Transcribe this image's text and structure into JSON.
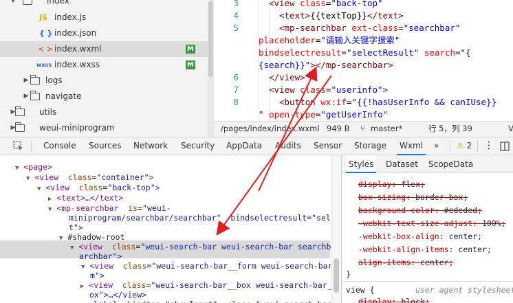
{
  "file_tree": {
    "items": [
      {
        "label": "index",
        "type": "folder",
        "expanded": true
      },
      {
        "label": "index.js",
        "type": "js",
        "icon": "JS"
      },
      {
        "label": "index.json",
        "type": "json",
        "icon": "{ }"
      },
      {
        "label": "index.wxml",
        "type": "wxml",
        "icon": "< >",
        "badge": "M",
        "selected": true
      },
      {
        "label": "index.wxss",
        "type": "wxss",
        "icon": "wxss",
        "badge": "M"
      },
      {
        "label": "logs",
        "type": "folder"
      },
      {
        "label": "navigate",
        "type": "folder"
      },
      {
        "label": "utils",
        "type": "folder"
      },
      {
        "label": "weui-miniprogram",
        "type": "folder"
      }
    ]
  },
  "editor": {
    "line_numbers": [
      "3",
      "4",
      "5",
      "6",
      "7",
      "8"
    ],
    "lines": [
      {
        "parts": [
          [
            "tag",
            "<view "
          ],
          [
            "attr",
            "class"
          ],
          [
            "txt",
            "="
          ],
          [
            "str",
            "\"back-top\""
          ]
        ]
      },
      {
        "parts": [
          [
            "tag",
            "<text>"
          ],
          [
            "txt",
            "{{textTop}}"
          ],
          [
            "tag",
            "</text>"
          ]
        ]
      },
      {
        "parts": [
          [
            "tag",
            "<mp-searchbar "
          ],
          [
            "attr",
            "ext-class"
          ],
          [
            "txt",
            "="
          ],
          [
            "str",
            "\"searchbar\""
          ]
        ]
      },
      {
        "parts": [
          [
            "attr",
            "placeholder"
          ],
          [
            "txt",
            "="
          ],
          [
            "str",
            "\"请输入关键字搜索\""
          ]
        ]
      },
      {
        "parts": [
          [
            "attr",
            "bindselectresult"
          ],
          [
            "txt",
            "="
          ],
          [
            "str",
            "\"selectResult\" "
          ],
          [
            "attr",
            "search"
          ],
          [
            "txt",
            "="
          ],
          [
            "str",
            "\"{"
          ]
        ]
      },
      {
        "parts": [
          [
            "str",
            "{search}}\""
          ],
          [
            "tag",
            "></mp-searchbar>"
          ]
        ]
      },
      {
        "parts": [
          [
            "tag",
            "</view>"
          ]
        ]
      },
      {
        "parts": [
          [
            "tag",
            "<view "
          ],
          [
            "attr",
            "class"
          ],
          [
            "txt",
            "="
          ],
          [
            "str",
            "\"userinfo\""
          ],
          [
            "tag",
            ">"
          ]
        ]
      },
      {
        "parts": [
          [
            "tag",
            "<button "
          ],
          [
            "attr",
            "wx:if"
          ],
          [
            "txt",
            "="
          ],
          [
            "str",
            "\"{{!hasUserInfo && canIUse}}"
          ]
        ]
      },
      {
        "parts": [
          [
            "str",
            "\" "
          ],
          [
            "attr",
            "open-type"
          ],
          [
            "txt",
            "="
          ],
          [
            "str",
            "\"getUserInfo\""
          ]
        ]
      }
    ]
  },
  "status_bar": {
    "path": "/pages/index/index.wxml",
    "size": "949 B",
    "branch": "master*",
    "position": "行 5，列 39",
    "extra": "V"
  },
  "devtools": {
    "tabs": [
      "Console",
      "Sources",
      "Network",
      "Security",
      "AppData",
      "Audits",
      "Sensor",
      "Storage",
      "Wxml"
    ],
    "active_tab": "Wxml",
    "more": "»",
    "warning_count": "2"
  },
  "dom_tree": {
    "lines": [
      {
        "indent": 0,
        "tri": "▼",
        "html": "<page>"
      },
      {
        "indent": 1,
        "tri": "▼",
        "tag": "view",
        "attrs": [
          [
            "class",
            "container"
          ]
        ]
      },
      {
        "indent": 2,
        "tri": "▼",
        "tag": "view",
        "attrs": [
          [
            "class",
            "back-top"
          ]
        ]
      },
      {
        "indent": 3,
        "tri": "▶",
        "tag": "text",
        "collapsed": "…</text>"
      },
      {
        "indent": 3,
        "tri": "▼",
        "tag": "mp-searchbar",
        "attrs": [
          [
            "is",
            "weui-"
          ]
        ]
      },
      {
        "indent": 4,
        "cont": "miniprogram/searchbar/searchbar\"  bindselectresult=\"selectResul"
      },
      {
        "indent": 4,
        "cont": "t\">"
      },
      {
        "indent": 4,
        "tri": "▼",
        "plain": "#shadow-root"
      },
      {
        "indent": 5,
        "tri": "▼",
        "tag": "view",
        "attrs": [
          [
            "class",
            "weui-search-bar weui-search-bar searchbar se"
          ]
        ]
      },
      {
        "indent": 5,
        "cont": "archbar\">"
      },
      {
        "indent": 6,
        "tri": "▼",
        "tag": "view",
        "attrs": [
          [
            "class",
            "weui-search-bar__form weui-search-bar__for"
          ]
        ]
      },
      {
        "indent": 6,
        "cont": "m\">"
      },
      {
        "indent": 7,
        "tri": "▶",
        "tag": "view",
        "attrs": [
          [
            "class",
            "weui-search-bar__box weui-search-bar__b"
          ]
        ]
      },
      {
        "indent": 7,
        "cont": "ox\">…</view>"
      },
      {
        "indent": 7,
        "tri": "▶",
        "tag": "label",
        "attrs": [
          [
            "bindtap",
            "showInput"
          ],
          [
            "class",
            "weui-search-bar__l"
          ]
        ]
      }
    ]
  },
  "styles_pane": {
    "tabs": [
      "Styles",
      "Dataset",
      "ScopeData"
    ],
    "active_tab": "Styles",
    "rules": [
      {
        "prop": "display",
        "value": "flex",
        "struck": true
      },
      {
        "prop": "box-sizing",
        "value": "border-box",
        "struck": true
      },
      {
        "prop": "background-color",
        "value": "#ededed",
        "struck": true
      },
      {
        "prop": "-webkit-text-size-adjust",
        "value": "100%",
        "struck": true
      },
      {
        "prop": "-webkit-box-align",
        "value": "center",
        "struck": false
      },
      {
        "prop": "-webkit-align-items",
        "value": "center",
        "struck": false
      },
      {
        "prop": "align-items",
        "value": "center",
        "struck": true
      }
    ],
    "close_brace": "}",
    "selector": "view {",
    "source": "user agent stylesheet",
    "last_rule": {
      "prop": "display",
      "value": "block",
      "struck": true
    }
  },
  "colors": {
    "arrow": "#e02020",
    "accent": "#1a73e8",
    "badge": "#3c9a3c"
  }
}
